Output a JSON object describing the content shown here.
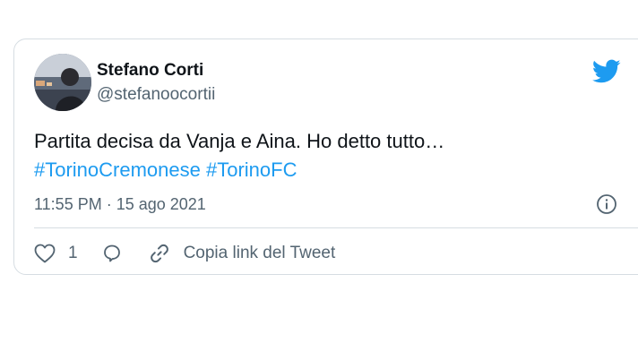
{
  "author": {
    "name": "Stefano Corti",
    "handle": "@stefanoocortii"
  },
  "tweet": {
    "text": "Partita decisa da Vanja e Aina. Ho detto tutto…",
    "hashtags": [
      "#TorinoCremonese",
      "#TorinoFC"
    ],
    "timestamp": "11:55 PM · 15 ago 2021"
  },
  "actions": {
    "like_count": "1",
    "copy_link_label": "Copia link del Tweet"
  },
  "icons": {
    "logo": "twitter-bird-icon",
    "info": "info-icon",
    "like": "heart-icon",
    "reply": "reply-bubble-icon",
    "copy": "link-icon"
  },
  "colors": {
    "accent": "#1d9bf0",
    "text": "#0f1419",
    "muted": "#536471",
    "border": "#d6dde2"
  }
}
